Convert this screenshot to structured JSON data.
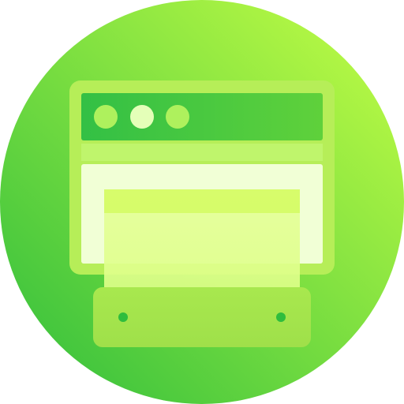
{
  "icon": {
    "name": "browser-window-printer-icon",
    "colors": {
      "circle_dark": "#2ebd3c",
      "circle_light": "#c6ff45",
      "frame": "#b6ee58",
      "title_bar": "#33c045",
      "title_bar_light": "#5fd13b",
      "stripe": "#bff56c",
      "content_panel": "#f1ffd6",
      "paper": "#e6ff9c",
      "paper_top": "#d4fb62",
      "tray": "#a8e84e",
      "dot": "#aef15d",
      "dot_middle": "#e4ffb8",
      "screw": "#2fbd3d"
    }
  }
}
